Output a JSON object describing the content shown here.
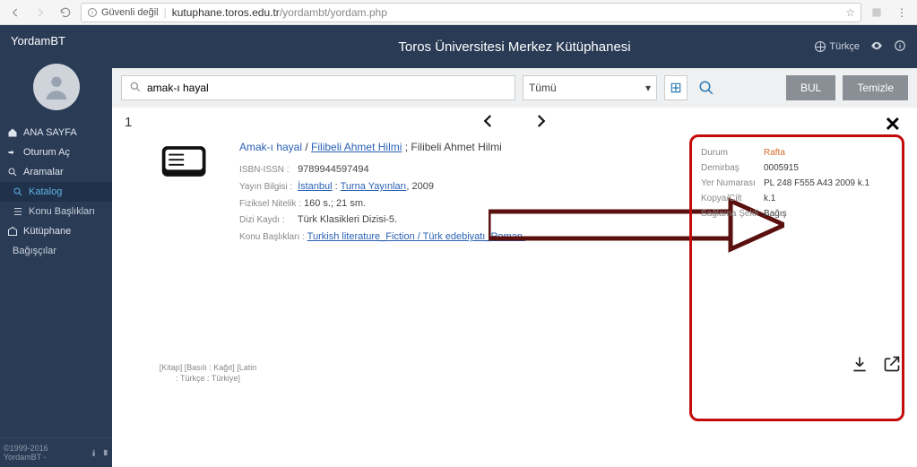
{
  "browser": {
    "security_label": "Güvenli değil",
    "url_host": "kutuphane.toros.edu.tr",
    "url_path": "/yordambt/yordam.php"
  },
  "brand": "YordamBT",
  "header_title": "Toros Üniversitesi Merkez Kütüphanesi",
  "lang_label": "Türkçe",
  "sidebar": {
    "home": "ANA SAYFA",
    "login": "Oturum Aç",
    "searches": "Aramalar",
    "catalog": "Katalog",
    "subjects": "Konu Başlıkları",
    "library": "Kütüphane",
    "donors": "Bağışçılar"
  },
  "footer": "©1999-2016 YordamBT -",
  "search": {
    "value": "amak-ı hayal",
    "scope": "Tümü",
    "find": "BUL",
    "clear": "Temizle"
  },
  "result_count": "1",
  "record": {
    "title_part1": "Amak-ı hayal",
    "title_sep": " / ",
    "title_part2": "Filibeli Ahmet Hilmi",
    "title_tail": " ; Filibeli Ahmet Hilmi",
    "isbn_label": "ISBN-ISSN :",
    "isbn": "9789944597494",
    "pub_label": "Yayın Bilgisi :",
    "pub_place": "İstanbul",
    "pub_colon": " : ",
    "pub_name": "Turna Yayınları",
    "pub_year": ", 2009",
    "phys_label": "Fiziksel Nitelik :",
    "phys": "160 s.; 21 sm.",
    "series_label": "Dizi Kaydı :",
    "series": "Türk Klasikleri Dizisi-5.",
    "subj_label": "Konu Başlıkları :",
    "subj": "Turkish literature_Fiction / Türk edebiyatı_Roman.",
    "tags": "[Kitap] [Basılı : Kağıt] [Latin : Türkçe : Türkiye]"
  },
  "detail": {
    "status_label": "Durum",
    "status": "Rafta",
    "inv_label": "Demirbaş",
    "inv": "0005915",
    "call_label": "Yer Numarası",
    "call": "PL 248 F555 A43 2009 k.1",
    "copy_label": "Kopya/Cilt",
    "copy": "k.1",
    "acq_label": "Sağlama Şekli",
    "acq": "Bağış"
  }
}
